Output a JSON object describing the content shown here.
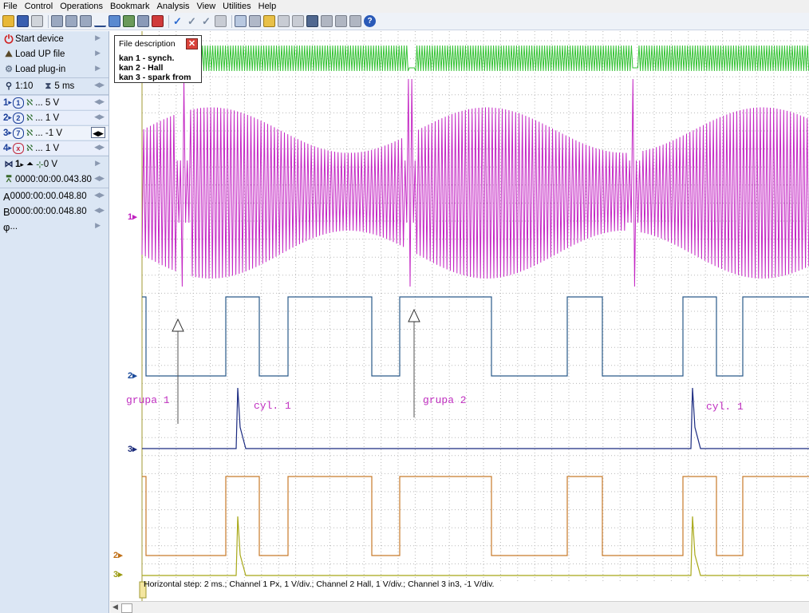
{
  "menu": [
    "File",
    "Control",
    "Operations",
    "Bookmark",
    "Analysis",
    "View",
    "Utilities",
    "Help"
  ],
  "toolbar_icons": [
    "open-icon",
    "save-icon",
    "print-icon",
    "copy-icon",
    "copy2-icon",
    "copy3-icon",
    "marker-icon",
    "cursor-icon",
    "measure-icon",
    "zoom-icon",
    "delete-icon",
    "check-icon",
    "check2-icon",
    "check3-icon",
    "page-icon",
    "grid-icon",
    "export-icon",
    "import-icon",
    "run-icon",
    "pause-icon",
    "settings-icon",
    "window1-icon",
    "window2-icon",
    "window3-icon",
    "help-icon"
  ],
  "sidebar": {
    "start_device": "Start device",
    "load_up_file": "Load UP file",
    "load_plugin": "Load plug-in",
    "zoom": "1:10",
    "timebase": "5 ms",
    "channels": [
      {
        "num": "1",
        "badge": "1",
        "value": "... 5 V",
        "color": "#1b3f9a"
      },
      {
        "num": "2",
        "badge": "2",
        "value": "... 1 V",
        "color": "#1b3f9a"
      },
      {
        "num": "3",
        "badge": "7",
        "value": "... -1 V",
        "color": "#1b3f9a"
      },
      {
        "num": "4",
        "badge": "x",
        "value": "... 1 V",
        "color": "#c0273a"
      }
    ],
    "trigger": {
      "channel": "1",
      "level": "0 V"
    },
    "trigger_time": "0000:00:00.043.80",
    "cursor_a": "0000:00:00.048.80",
    "cursor_b": "0000:00:00.048.80",
    "phi": "..."
  },
  "file_description": {
    "title": "File description",
    "lines": [
      "kan 1 - synch.",
      "kan 2 - Hall",
      "kan 3 - spark from"
    ]
  },
  "scope": {
    "status_text": "Horizontal step: 2 ms.; Channel 1 Px, 1 V/div.; Channel 2 Hall, 1 V/div.; Channel 3 in3, -1 V/div.",
    "channel_markers": [
      {
        "label": "1▸",
        "color": "#c020c0"
      },
      {
        "label": "2▸",
        "color": "#1a4a9a"
      },
      {
        "label": "3▸",
        "color": "#1a2a7a"
      },
      {
        "label": "2▸",
        "color": "#c07018"
      },
      {
        "label": "3▸",
        "color": "#9a9a10"
      }
    ],
    "annotations": [
      "grupa 1",
      "cyl. 1",
      "grupa 2",
      "cyl. 1"
    ],
    "colors": {
      "sync": "#33c233",
      "ch1": "#c427c4",
      "hall_top": "#2a5a8a",
      "spark_top": "#1a2a80",
      "hall_bottom": "#c77a2a",
      "spark_bottom": "#a8a818",
      "grid": "#b8b8b8",
      "annotation": "#c030c0"
    }
  }
}
